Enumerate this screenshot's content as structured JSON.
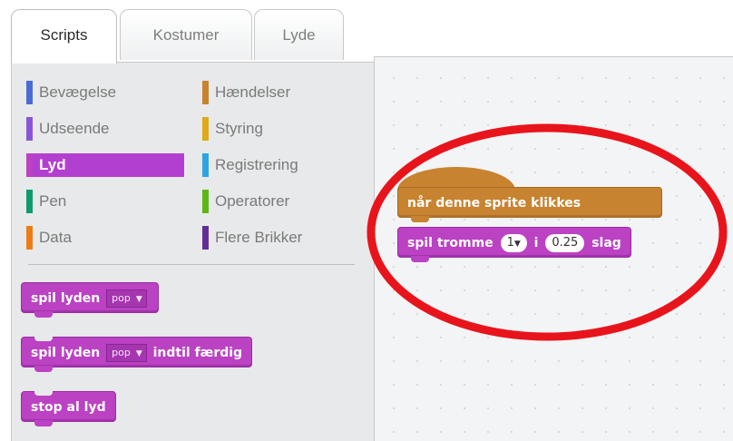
{
  "tabs": [
    {
      "label": "Scripts",
      "active": true
    },
    {
      "label": "Kostumer",
      "active": false
    },
    {
      "label": "Lyde",
      "active": false
    }
  ],
  "categories": [
    {
      "label": "Bevægelse",
      "color": "#4a6cd4",
      "selected": false
    },
    {
      "label": "Udseende",
      "color": "#8a55d7",
      "selected": false
    },
    {
      "label": "Lyd",
      "color": "#bb42c3",
      "selected": true
    },
    {
      "label": "Pen",
      "color": "#0e9a6c",
      "selected": false
    },
    {
      "label": "Data",
      "color": "#ee7d16",
      "selected": false
    },
    {
      "label": "Hændelser",
      "color": "#c88330",
      "selected": false
    },
    {
      "label": "Styring",
      "color": "#e1a91a",
      "selected": false
    },
    {
      "label": "Registrering",
      "color": "#2ca5e2",
      "selected": false
    },
    {
      "label": "Operatorer",
      "color": "#5cb712",
      "selected": false
    },
    {
      "label": "Flere Brikker",
      "color": "#632d99",
      "selected": false
    }
  ],
  "palette_blocks": {
    "play_sound": {
      "text": "spil lyden",
      "sound": "pop"
    },
    "play_sound_until_done": {
      "text": "spil lyden",
      "sound": "pop",
      "suffix": "indtil færdig"
    },
    "stop_all_sounds": {
      "text": "stop al lyd"
    }
  },
  "script": {
    "hat": {
      "text": "når denne sprite klikkes"
    },
    "play_drum": {
      "text": "spil tromme",
      "drum": "1",
      "joiner": "i",
      "beats": "0.25",
      "suffix": "slag"
    }
  },
  "colors": {
    "sound": "#bb42c3",
    "events": "#c88330",
    "highlight": "#e8141c"
  }
}
